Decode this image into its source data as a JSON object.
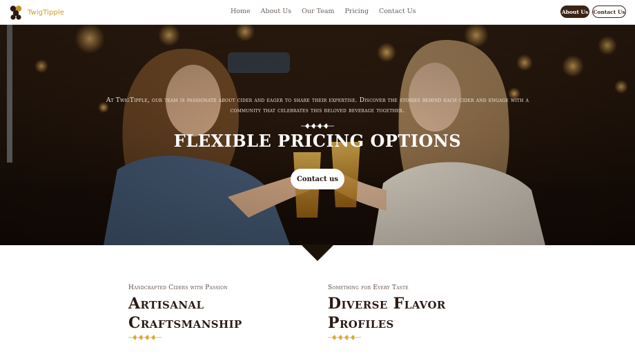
{
  "header": {
    "brand": "TwigTipple",
    "logo_icon": "honeycomb-logo-icon",
    "nav": [
      {
        "label": "Home"
      },
      {
        "label": "About Us"
      },
      {
        "label": "Our Team"
      },
      {
        "label": "Pricing"
      },
      {
        "label": "Contact Us"
      }
    ],
    "about_button": "About Us",
    "contact_button": "Contact Us"
  },
  "hero": {
    "intro": "At TwigTipple, our team is passionate about cider and eager to share their expertise. Discover the stories behind each cider and engage with a community that celebrates this beloved beverage together.",
    "title": "FLEXIBLE PRICING OPTIONS",
    "cta": "Contact us",
    "ornament_icon": "wheat-ornament-icon"
  },
  "features": [
    {
      "eyebrow": "Handcrafted Ciders with Passion",
      "title": "Artisanal Craftsmanship",
      "ornament_icon": "wheat-ornament-icon"
    },
    {
      "eyebrow": "Something for Every Taste",
      "title": "Diverse Flavor Profiles",
      "ornament_icon": "wheat-ornament-icon"
    }
  ],
  "colors": {
    "brand": "#d19a1e",
    "dark_brown": "#3b2416",
    "ornament_gold": "#e0a82e"
  }
}
